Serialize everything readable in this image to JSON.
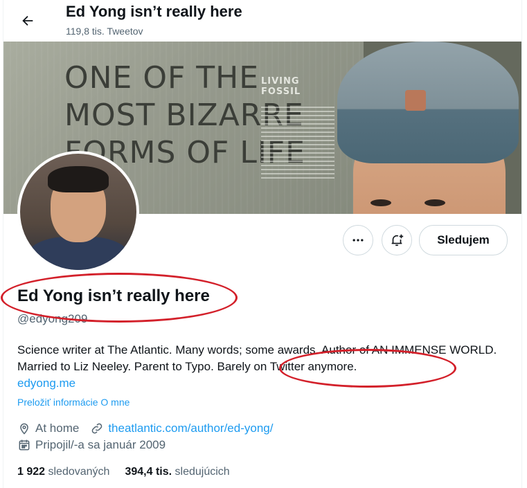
{
  "header": {
    "name": "Ed Yong isn’t really here",
    "tweet_count": "119,8 tis. Tweetov"
  },
  "banner": {
    "sign_lines": [
      "ONE OF THE",
      "MOST BIZARRE",
      "FORMS OF LIFE"
    ],
    "sign_sub": [
      "LIVING",
      "FOSSIL"
    ]
  },
  "actions": {
    "more_icon": "ellipsis-icon",
    "notify_icon": "bell-plus-icon",
    "follow_label": "Sledujem"
  },
  "profile": {
    "name": "Ed Yong isn’t really here",
    "handle": "@edyong209",
    "bio_text": "Science writer at The Atlantic. Many words; some awards. Author of AN IMMENSE WORLD. Married to Liz Neeley. Parent to Typo. Barely on Twitter anymore.",
    "bio_link": "edyong.me",
    "translate": "Preložiť informácie O mne",
    "location": "At home",
    "website": "theatlantic.com/author/ed-yong/",
    "joined": "Pripojil/-a sa január 2009"
  },
  "stats": {
    "following_count": "1 922",
    "following_label": "sledovaných",
    "followers_count": "394,4 tis.",
    "followers_label": "sledujúcich"
  },
  "colors": {
    "accent": "#1d9bf0",
    "annotation": "#d3202a",
    "secondary_text": "#536471"
  }
}
